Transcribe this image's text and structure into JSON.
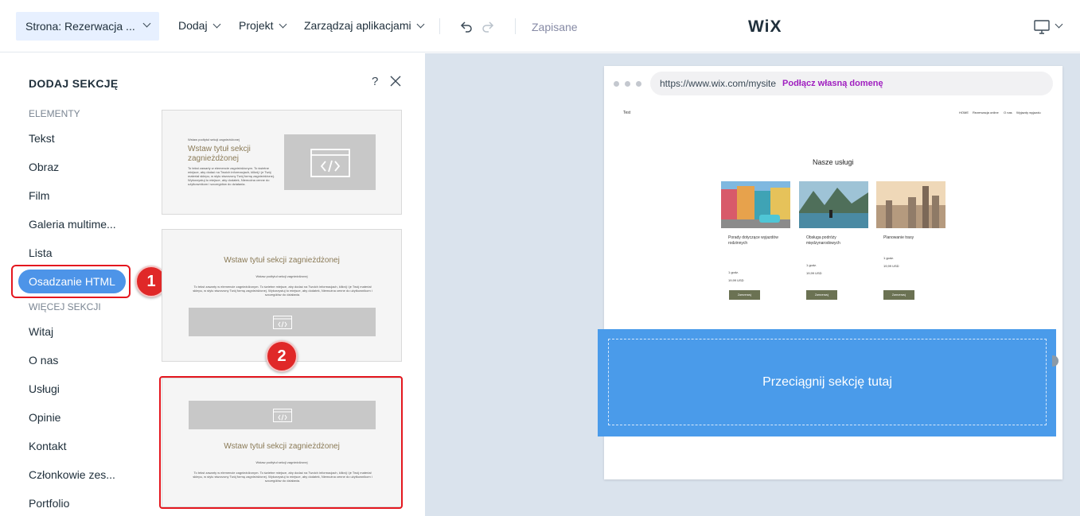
{
  "topbar": {
    "page_select": "Strona: Rezerwacja ...",
    "menu": [
      "Dodaj",
      "Projekt",
      "Zarządzaj aplikacjami"
    ],
    "saved": "Zapisane",
    "logo": "WiX"
  },
  "panel": {
    "title": "DODAJ SEKCJĘ",
    "help": "?",
    "elements_head": "ELEMENTY",
    "elements": [
      "Tekst",
      "Obraz",
      "Film",
      "Galeria multime...",
      "Lista"
    ],
    "active": "Osadzanie HTML",
    "more_head": "WIĘCEJ SEKCJI",
    "more": [
      "Witaj",
      "O nas",
      "Usługi",
      "Opinie",
      "Kontakt",
      "Członkowie zes...",
      "Portfolio"
    ],
    "badges": [
      "1",
      "2"
    ]
  },
  "thumbs": [
    {
      "subtitle": "Wstaw podtytuł sekcji zagnieżdżonej",
      "title": "Wstaw tytuł sekcji zagnieżdżonej",
      "body": "To tekst zawarty w elemencie zagnieżdżonym. To świetne miejsce, aby dodać na Twoich informacjach, kliknij i je Twój materiał sklepu, w stylu stworzony Twój formę zagnieżdżonej. Wykorzystuj to miejsce, aby dodatek, Niemożna cenne do użytkownikom i szczegółów do działania."
    },
    {
      "title": "Wstaw tytuł sekcji zagnieżdżonej",
      "subtitle": "Wstaw podtytuł sekcji zagnieżdżonej",
      "body": "To tekst zawarty w elemencie zagnieżdżonym. To świetne miejsce, aby dodać na Twoich informacjach, kliknij i je Twój materiał sklepu, w stylu stworzony Twój formę zagnieżdżonej. Wykorzystuj to miejsce, aby dodatek, Niemożna cenne do użytkownikom i szczegółów do działania."
    },
    {
      "title": "Wstaw tytuł sekcji zagnieżdżonej",
      "subtitle": "Wstaw podtytuł sekcji zagnieżdżonej",
      "body": "To tekst zawarty w elemencie zagnieżdżonym. To świetne miejsce, aby dodać na Twoich informacjach, kliknij i je Twój materiał sklepu, w stylu stworzony Twój formę zagnieżdżonej. Wykorzystuj to miejsce, aby dodatek, Niemożna cenne do użytkownikom i szczegółów do działania."
    }
  ],
  "browser": {
    "url": "https://www.wix.com/mysite",
    "domain_link": "Podłącz własną domenę",
    "site_logo": "Test",
    "nav": [
      "HOME",
      "Rezerwacja online",
      "O nas",
      "Wyjazdy wyjazdu"
    ],
    "services_title": "Nasze usługi",
    "cards": [
      {
        "name": "Porady dotyczące wyjazdów rodzinnych",
        "duration": "1 godz.",
        "price": "19,99 USD",
        "button": "Zarezerwuj"
      },
      {
        "name": "Obsługa podróży międzynarodowych",
        "duration": "1 godz.",
        "price": "19,99 USD",
        "button": "Zarezerwuj"
      },
      {
        "name": "Planowanie trasy",
        "duration": "1 godz.",
        "price": "19,99 USD",
        "button": "Zarezerwuj"
      }
    ],
    "drop_zone": "Przeciągnij sekcję tutaj"
  }
}
